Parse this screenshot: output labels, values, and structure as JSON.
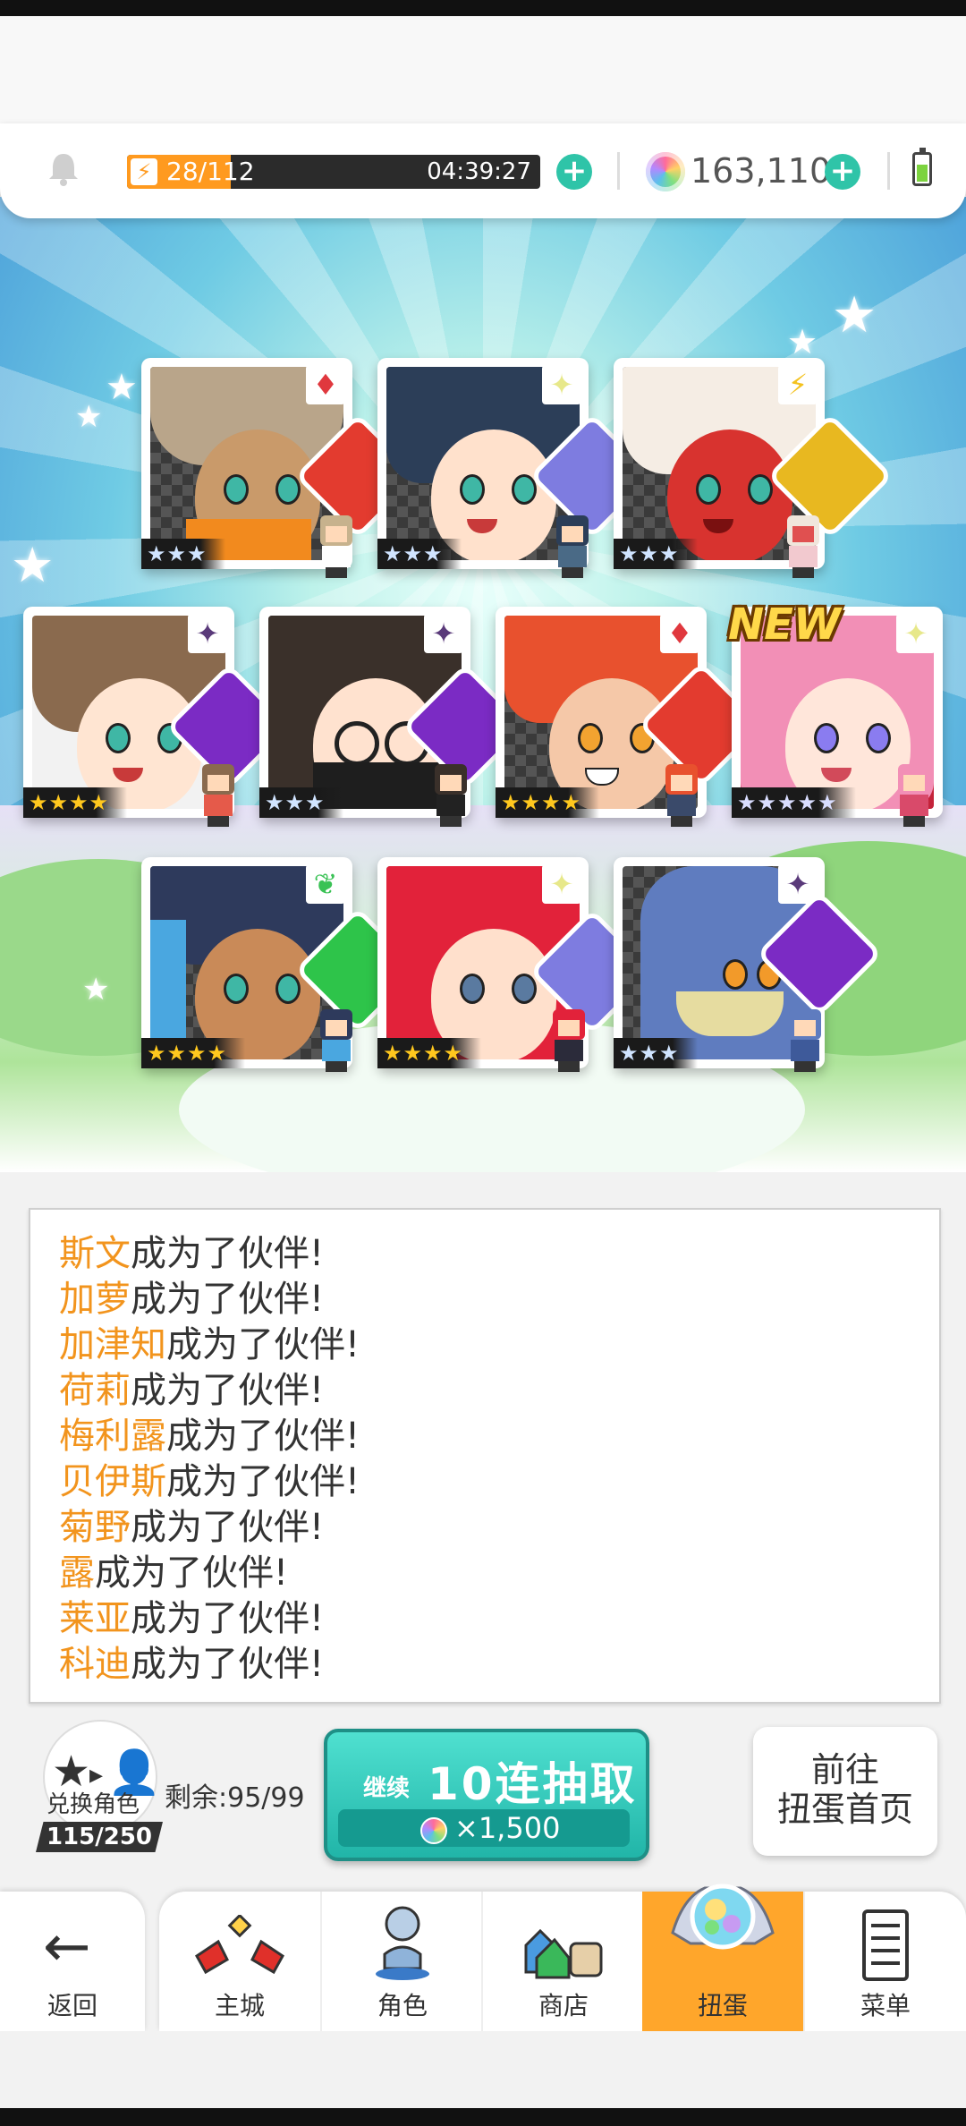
{
  "topbar": {
    "stamina_current_text": "28/",
    "stamina_max_text": "112",
    "stamina_fraction": 0.25,
    "stamina_timer": "04:39:27",
    "gems": "163,110"
  },
  "cards": [
    {
      "stars": "★★★",
      "element": "fire",
      "element_glyph": "♦",
      "crest": "fire-crest"
    },
    {
      "stars": "★★★",
      "element": "light",
      "element_glyph": "✦",
      "crest": "light-crest"
    },
    {
      "stars": "★★★",
      "element": "thunder",
      "element_glyph": "⚡",
      "crest": "thunder-crest"
    },
    {
      "stars": "★★★★",
      "element": "dark",
      "element_glyph": "✦",
      "crest": "dark-crest"
    },
    {
      "stars": "★★★",
      "element": "dark",
      "element_glyph": "✦",
      "crest": "dark-crest"
    },
    {
      "stars": "★★★★",
      "element": "fire",
      "element_glyph": "♦",
      "crest": "fire-crest"
    },
    {
      "stars": "★★★★★",
      "element": "light",
      "element_glyph": "✦",
      "crest": "light-crest",
      "new": "NEW"
    },
    {
      "stars": "★★★★",
      "element": "wind",
      "element_glyph": "❦",
      "crest": "wind-crest"
    },
    {
      "stars": "★★★★",
      "element": "light",
      "element_glyph": "✦",
      "crest": "light-crest"
    },
    {
      "stars": "★★★",
      "element": "dark",
      "element_glyph": "✦",
      "crest": "dark-crest"
    }
  ],
  "log": [
    {
      "name": "斯文",
      "text": "成为了伙伴!"
    },
    {
      "name": "加萝",
      "text": "成为了伙伴!"
    },
    {
      "name": "加津知",
      "text": "成为了伙伴!"
    },
    {
      "name": "荷莉",
      "text": "成为了伙伴!"
    },
    {
      "name": "梅利露",
      "text": "成为了伙伴!"
    },
    {
      "name": "贝伊斯",
      "text": "成为了伙伴!"
    },
    {
      "name": "菊野",
      "text": "成为了伙伴!"
    },
    {
      "name": "露",
      "text": "成为了伙伴!"
    },
    {
      "name": "莱亚",
      "text": "成为了伙伴!"
    },
    {
      "name": "科迪",
      "text": "成为了伙伴!"
    }
  ],
  "exchange": {
    "label": "兑换角色",
    "count": "115/250"
  },
  "remaining": "剩余:95/99",
  "draw": {
    "continue_label": "继续",
    "title": "10连抽取",
    "cost": "×1,500"
  },
  "gacha_home": {
    "line1": "前往",
    "line2": "扭蛋首页"
  },
  "nav": {
    "back": "返回",
    "tabs": [
      {
        "label": "主城"
      },
      {
        "label": "角色"
      },
      {
        "label": "商店"
      },
      {
        "label": "扭蛋"
      },
      {
        "label": "菜单"
      }
    ]
  },
  "colors": {
    "accent_orange": "#ffa62b",
    "teal": "#2fc4a8",
    "log_name": "#f2941d"
  }
}
